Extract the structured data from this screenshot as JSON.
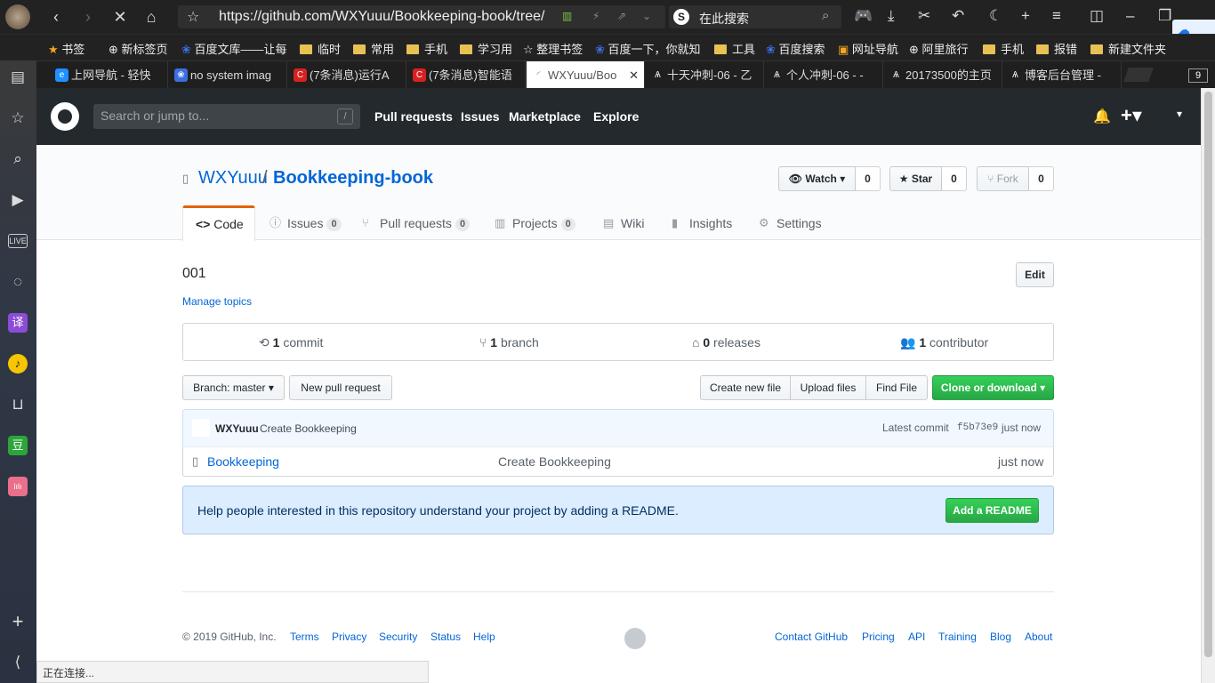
{
  "browser": {
    "url": "https://github.com/WXYuuu/Bookkeeping-book/tree/",
    "search_placeholder": "在此搜索",
    "bookmarks": [
      "书签",
      "新标签页",
      "百度文库——让每",
      "临时",
      "常用",
      "手机",
      "学习用",
      "整理书签",
      "百度一下，你就知",
      "工具",
      "百度搜索",
      "网址导航",
      "阿里旅行",
      "手机",
      "报错",
      "新建文件夹"
    ],
    "tabs": [
      "上网导航 - 轻快",
      "no system imag",
      "(7条消息)运行A",
      "(7条消息)智能语",
      "WXYuuu/Boo",
      "十天冲刺-06 - 乙",
      "个人冲刺-06 - -",
      "20173500的主页",
      "博客后台管理 -"
    ],
    "tab_count": "9",
    "status": "正在连接..."
  },
  "github": {
    "search_placeholder": "Search or jump to...",
    "search_key": "/",
    "nav": [
      "Pull requests",
      "Issues",
      "Marketplace",
      "Explore"
    ]
  },
  "repo": {
    "owner": "WXYuuu",
    "separator": "/",
    "name": "Bookkeeping-book",
    "watch_label": "Watch",
    "watch_count": "0",
    "star_label": "Star",
    "star_count": "0",
    "fork_label": "Fork",
    "fork_count": "0",
    "tabs": {
      "code": "Code",
      "issues": "Issues",
      "issues_count": "0",
      "pulls": "Pull requests",
      "pulls_count": "0",
      "projects": "Projects",
      "projects_count": "0",
      "wiki": "Wiki",
      "insights": "Insights",
      "settings": "Settings"
    },
    "description": "001",
    "manage_topics": "Manage topics",
    "edit_label": "Edit",
    "summary": {
      "commits_num": "1",
      "commits_label": "commit",
      "branch_num": "1",
      "branch_label": "branch",
      "releases_num": "0",
      "releases_label": "releases",
      "contrib_num": "1",
      "contrib_label": "contributor"
    },
    "branch_button": "Branch: master",
    "new_pr": "New pull request",
    "create_file": "Create new file",
    "upload_files": "Upload files",
    "find_file": "Find File",
    "clone": "Clone or download",
    "commit": {
      "author": "WXYuuu",
      "message": "Create Bookkeeping",
      "latest_label": "Latest commit",
      "sha": "f5b73e9",
      "time": "just now"
    },
    "files": [
      {
        "name": "Bookkeeping",
        "message": "Create Bookkeeping",
        "age": "just now"
      }
    ],
    "readme_text": "Help people interested in this repository understand your project by adding a README.",
    "add_readme": "Add a README"
  },
  "footer": {
    "copyright": "© 2019 GitHub, Inc.",
    "left_links": [
      "Terms",
      "Privacy",
      "Security",
      "Status",
      "Help"
    ],
    "right_links": [
      "Contact GitHub",
      "Pricing",
      "API",
      "Training",
      "Blog",
      "About"
    ]
  },
  "colors": {
    "accent": "#0366d6",
    "header": "#24292e",
    "green": "#28a745",
    "tab_orange": "#e36209"
  }
}
